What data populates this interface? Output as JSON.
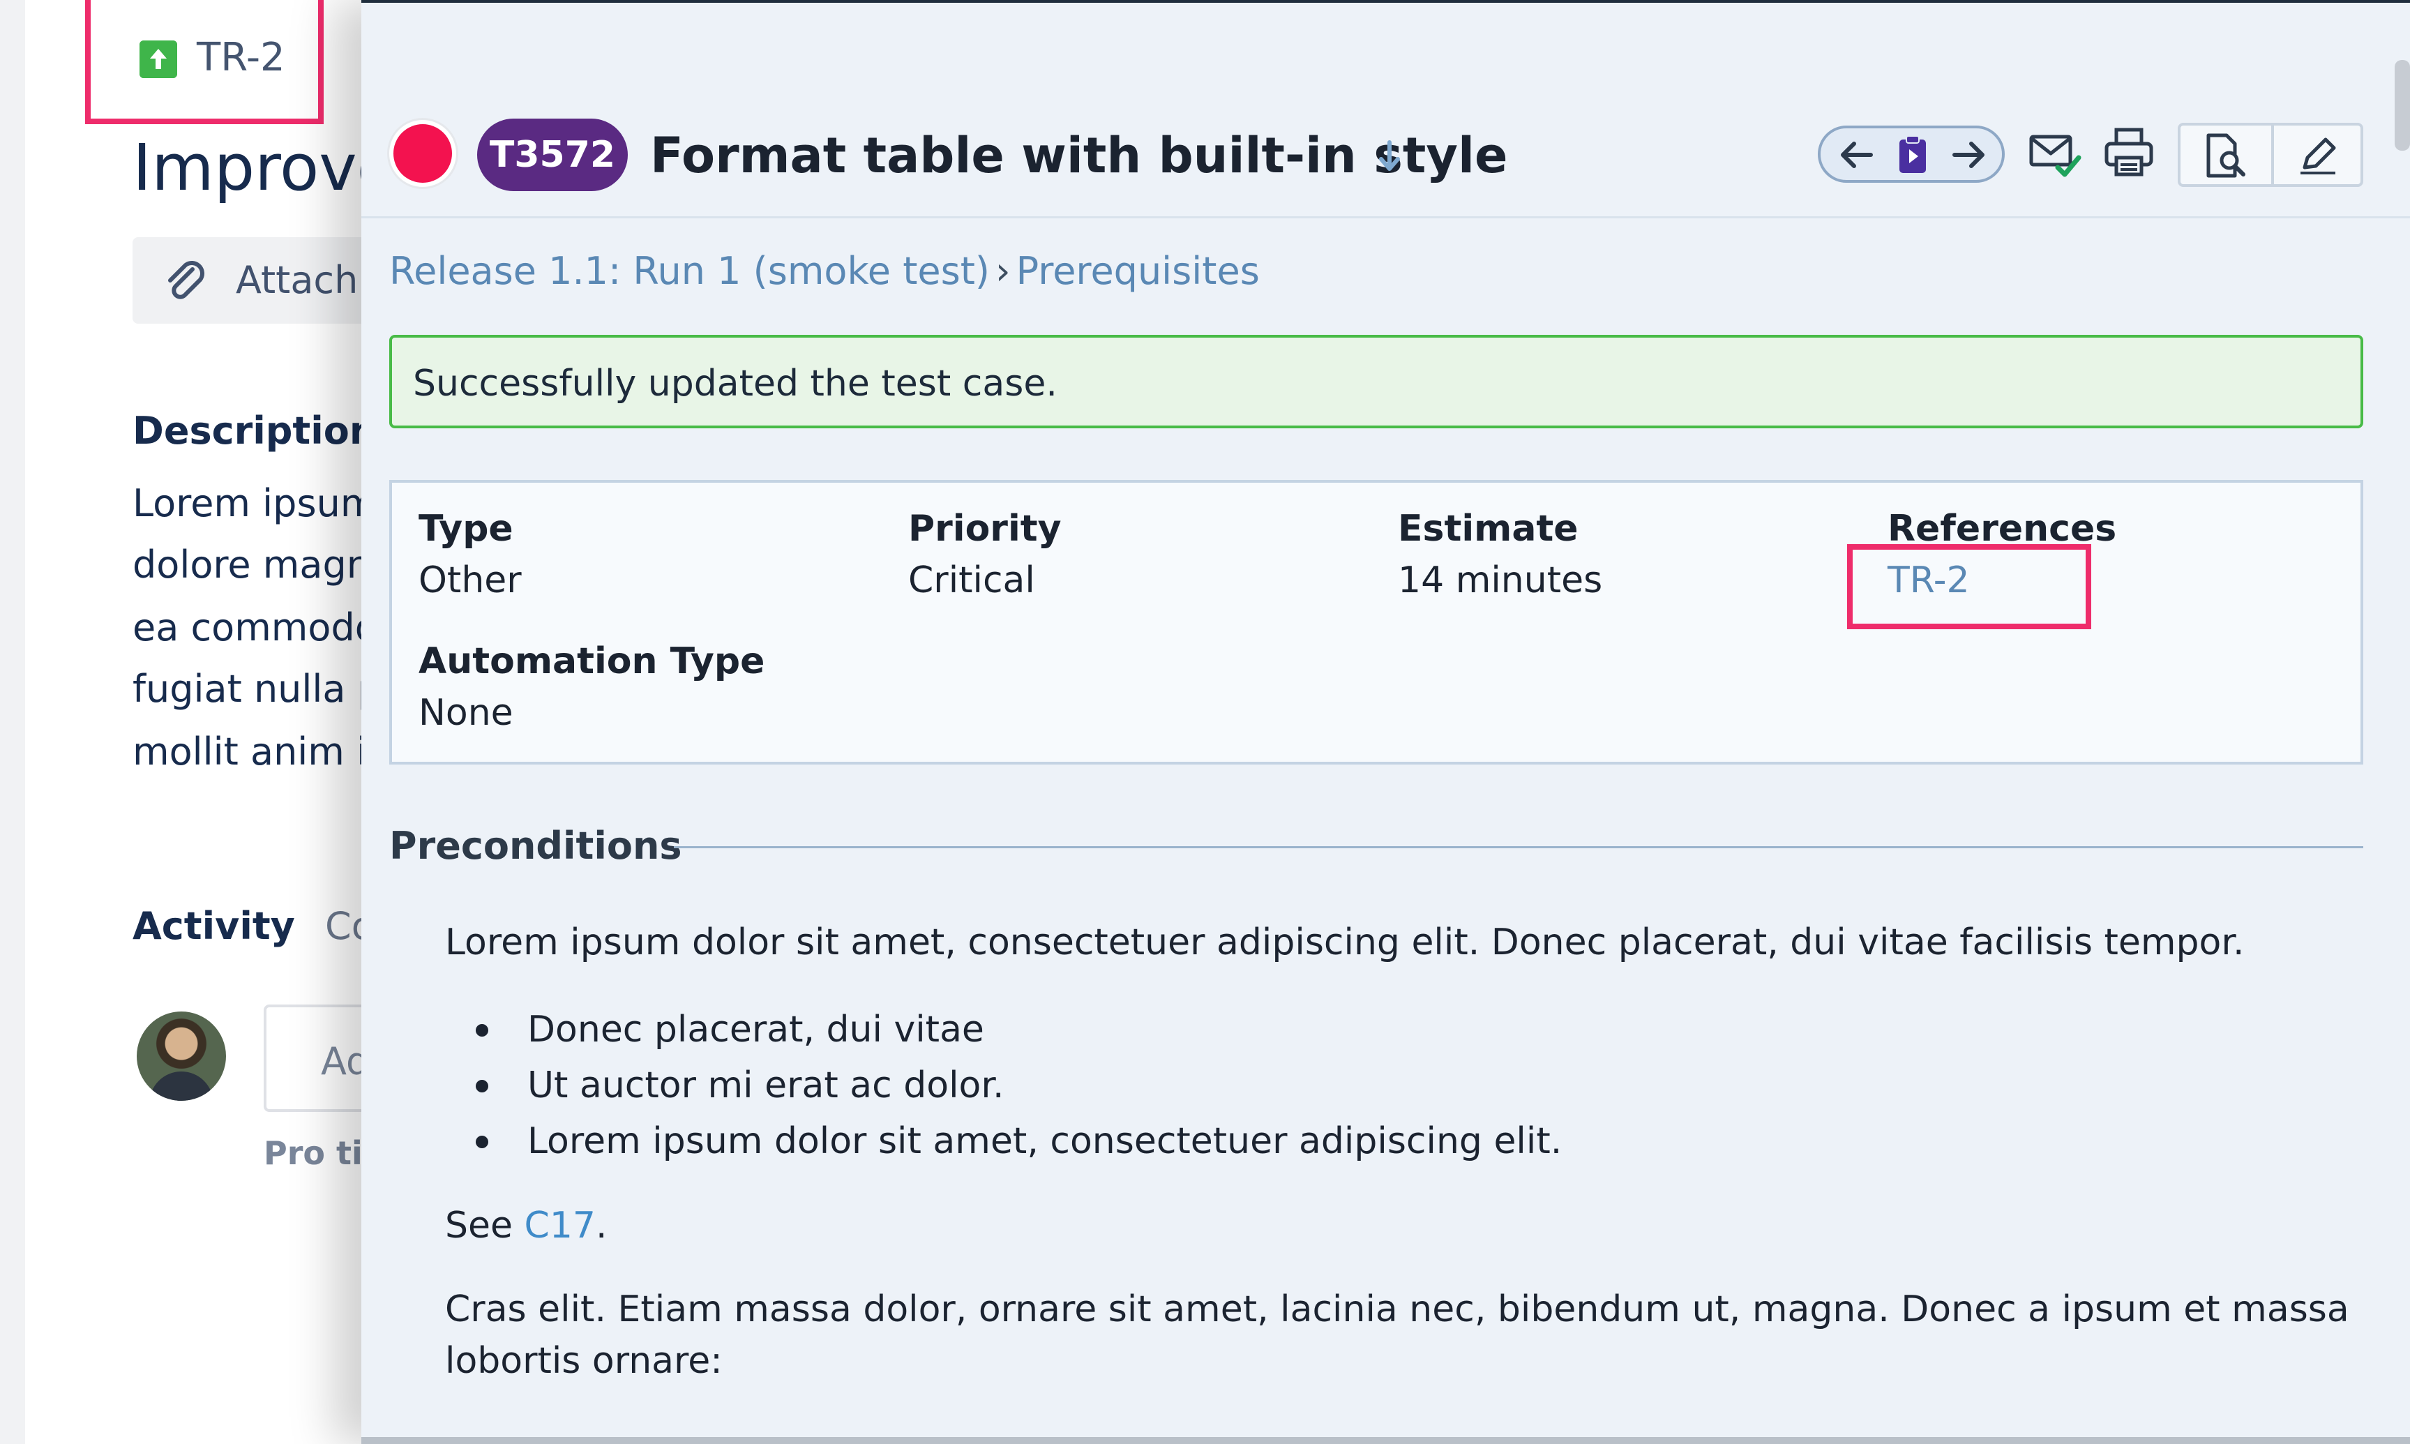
{
  "background_issue": {
    "key": "TR-2",
    "title": "Improve",
    "attach_label": "Attach",
    "description_heading": "Description",
    "description_lines": [
      "Lorem ipsum",
      "dolore magna",
      "ea commodo",
      "fugiat nulla pa",
      "mollit anim id"
    ],
    "activity_heading": "Activity",
    "activity_tab_partial": "Co",
    "comment_placeholder": "Ad",
    "pro_tip": "Pro tip"
  },
  "panel": {
    "status_color": "#f3124f",
    "case_id": "T3572",
    "title": "Format table with built-in style",
    "toolbar": {
      "prev_icon": "arrow-left-icon",
      "clipboard_icon": "clipboard-play-icon",
      "next_icon": "arrow-right-icon",
      "email_icon": "email-check-icon",
      "print_icon": "printer-icon",
      "view_icon": "document-search-icon",
      "edit_icon": "pencil-icon"
    },
    "breadcrumb": {
      "run": "Release 1.1: Run 1 (smoke test)",
      "separator": "›",
      "section": "Prerequisites"
    },
    "success_message": "Successfully updated the test case.",
    "fields": {
      "type_label": "Type",
      "type_value": "Other",
      "priority_label": "Priority",
      "priority_value": "Critical",
      "estimate_label": "Estimate",
      "estimate_value": "14 minutes",
      "references_label": "References",
      "references_value": "TR-2",
      "automation_label": "Automation Type",
      "automation_value": "None"
    },
    "preconditions": {
      "heading": "Preconditions",
      "paragraph1": "Lorem ipsum dolor sit amet, consectetuer adipiscing elit. Donec placerat, dui vitae facilisis tempor.",
      "bullets": [
        "Donec placerat, dui vitae",
        "Ut auctor mi erat ac dolor.",
        "Lorem ipsum dolor sit amet, consectetuer adipiscing elit."
      ],
      "see_prefix": "See ",
      "see_link": "C17",
      "see_suffix": ".",
      "paragraph3": "Cras elit. Etiam massa dolor, ornare sit amet, lacinia nec, bibendum ut, magna. Donec a ipsum et massa lobortis ornare:"
    }
  },
  "colors": {
    "highlight": "#ee2c6b",
    "case_badge": "#5a2a82",
    "link": "#5a88b4",
    "success_border": "#48bb47"
  }
}
